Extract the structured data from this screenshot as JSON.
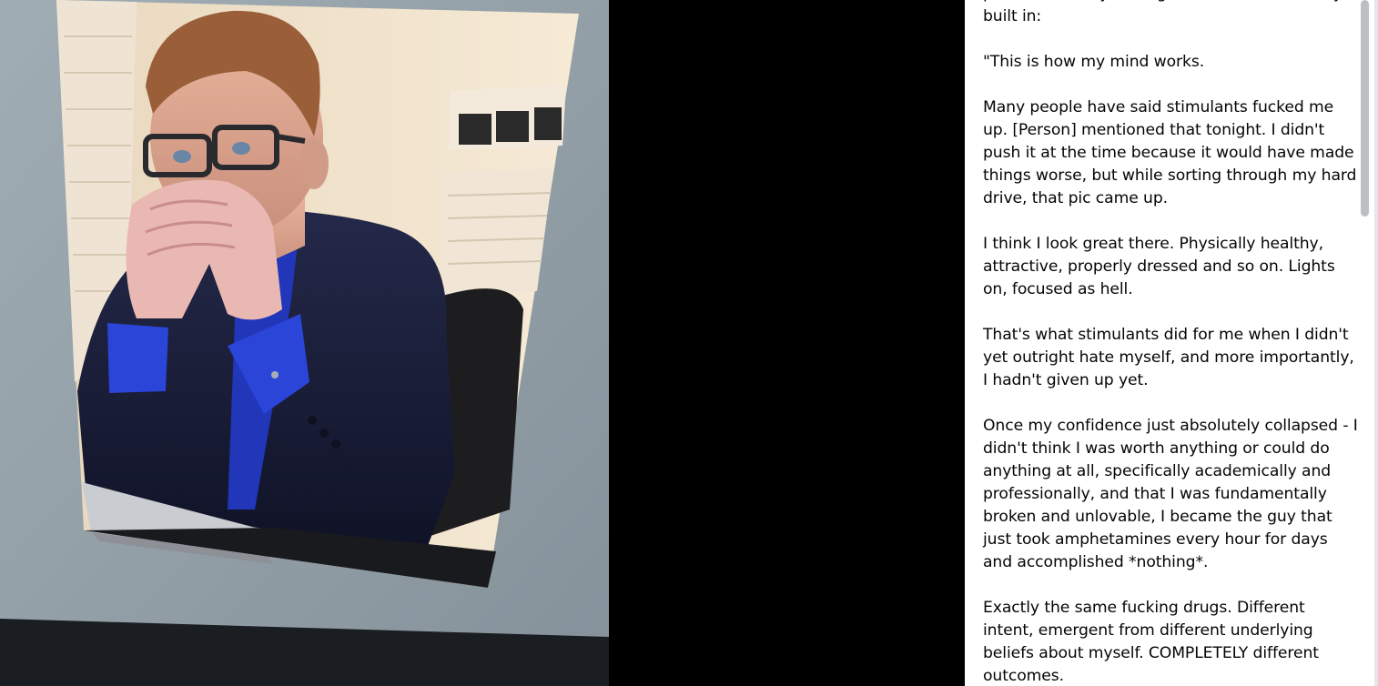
{
  "post": {
    "paragraphs": [
      "photo from six years ago. The context is really built in:",
      "\"This is how my mind works.",
      "Many people have said stimulants fucked me up. [Person] mentioned that tonight. I didn't push it at the time because it would have made things worse, but while sorting through my hard drive, that pic came up.",
      "I think I look great there. Physically healthy, attractive, properly dressed and so on. Lights on, focused as hell.",
      "That's what stimulants did for me when I didn't yet outright hate myself, and more importantly, I hadn't given up yet.",
      "Once my confidence just absolutely collapsed - I didn't think I was worth anything or could do anything at all, specifically academically and professionally, and that I was fundamentally broken and unlovable, I became the guy that just took amphetamines every hour for days and accomplished *nothing*.",
      "Exactly the same fucking drugs. Different intent, emergent from different underlying beliefs about myself. COMPLETELY different outcomes."
    ]
  },
  "photo": {
    "subject": "man-in-suit-glasses-hands-clasped-photo",
    "icon": "photo-image"
  },
  "colors": {
    "viewer_background": "#000000",
    "panel_background": "#ffffff",
    "text": "#050505",
    "scroll_thumb": "#bcc0c4"
  }
}
